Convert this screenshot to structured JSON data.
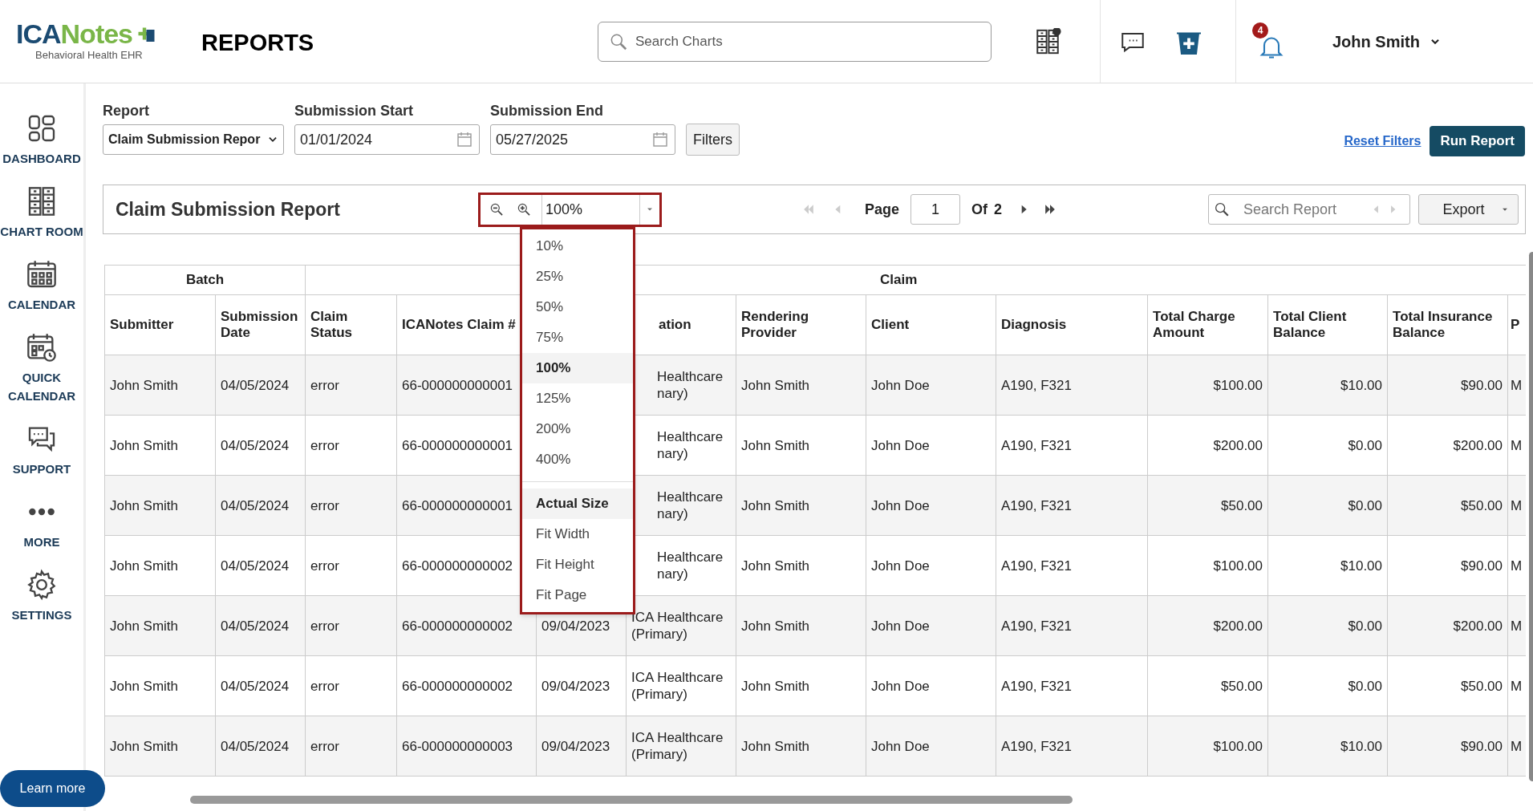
{
  "header": {
    "logo": {
      "brand_prefix": "ICA",
      "brand_suffix": "Notes",
      "tagline": "Behavioral Health EHR"
    },
    "page_title": "REPORTS",
    "search": {
      "placeholder": "Search Charts"
    },
    "notification_count": "4",
    "user": "John Smith"
  },
  "sidebar": {
    "items": [
      {
        "label": "DASHBOARD"
      },
      {
        "label": "CHART ROOM"
      },
      {
        "label": "CALENDAR"
      },
      {
        "label": "QUICK CALENDAR"
      },
      {
        "label": "SUPPORT"
      },
      {
        "label": "MORE"
      },
      {
        "label": "SETTINGS"
      }
    ],
    "learn_more": "Learn more"
  },
  "filters": {
    "report": {
      "label": "Report",
      "value": "Claim Submission Repor"
    },
    "start": {
      "label": "Submission Start",
      "value": "01/01/2024"
    },
    "end": {
      "label": "Submission End",
      "value": "05/27/2025"
    },
    "filters_button": "Filters",
    "reset": "Reset Filters",
    "run": "Run Report"
  },
  "viewer": {
    "title": "Claim Submission Report",
    "zoom": "100%",
    "page_label": "Page",
    "page": "1",
    "of_label": "Of",
    "page_count": "2",
    "search": {
      "placeholder": "Search Report"
    },
    "export": "Export"
  },
  "zoom_menu": [
    {
      "label": "10%",
      "kind": "zoom",
      "selected": false
    },
    {
      "label": "25%",
      "kind": "zoom",
      "selected": false
    },
    {
      "label": "50%",
      "kind": "zoom",
      "selected": false
    },
    {
      "label": "75%",
      "kind": "zoom",
      "selected": false
    },
    {
      "label": "100%",
      "kind": "zoom",
      "selected": true
    },
    {
      "label": "125%",
      "kind": "zoom",
      "selected": false
    },
    {
      "label": "200%",
      "kind": "zoom",
      "selected": false
    },
    {
      "label": "400%",
      "kind": "zoom",
      "selected": false
    },
    {
      "label": "Actual Size",
      "kind": "fit",
      "selected": true
    },
    {
      "label": "Fit Width",
      "kind": "fit",
      "selected": false
    },
    {
      "label": "Fit Height",
      "kind": "fit",
      "selected": false
    },
    {
      "label": "Fit Page",
      "kind": "fit",
      "selected": false
    }
  ],
  "table": {
    "groups": [
      {
        "label": "Batch"
      },
      {
        "label": "Claim"
      }
    ],
    "columns": [
      {
        "label": "Submitter"
      },
      {
        "label": "Submission Date"
      },
      {
        "label": "Claim Status"
      },
      {
        "label": "ICANotes Claim #"
      },
      {},
      {
        "label": "ation"
      },
      {
        "label": "Rendering Provider"
      },
      {
        "label": "Client"
      },
      {
        "label": "Diagnosis"
      },
      {
        "label": "Total Charge Amount"
      },
      {
        "label": "Total Client Balance"
      },
      {
        "label": "Total Insurance Balance"
      },
      {
        "label": "P"
      }
    ],
    "rows": [
      {
        "under_menu": true,
        "cells": [
          "John Smith",
          "04/05/2024",
          "error",
          "66-000000000001",
          null,
          "Healthcare nary)",
          "John Smith",
          "John Doe",
          "A190, F321",
          "$100.00",
          "$10.00",
          "$90.00",
          "M"
        ]
      },
      {
        "under_menu": true,
        "cells": [
          "John Smith",
          "04/05/2024",
          "error",
          "66-000000000001",
          null,
          "Healthcare nary)",
          "John Smith",
          "John Doe",
          "A190, F321",
          "$200.00",
          "$0.00",
          "$200.00",
          "M"
        ]
      },
      {
        "under_menu": true,
        "cells": [
          "John Smith",
          "04/05/2024",
          "error",
          "66-000000000001",
          null,
          "Healthcare nary)",
          "John Smith",
          "John Doe",
          "A190, F321",
          "$50.00",
          "$0.00",
          "$50.00",
          "M"
        ]
      },
      {
        "under_menu": true,
        "cells": [
          "John Smith",
          "04/05/2024",
          "error",
          "66-000000000002",
          null,
          "Healthcare nary)",
          "John Smith",
          "John Doe",
          "A190, F321",
          "$100.00",
          "$10.00",
          "$90.00",
          "M"
        ]
      },
      {
        "under_menu": false,
        "cells": [
          "John Smith",
          "04/05/2024",
          "error",
          "66-000000000002",
          "09/04/2023",
          "ICA Healthcare (Primary)",
          "John Smith",
          "John Doe",
          "A190, F321",
          "$200.00",
          "$0.00",
          "$200.00",
          "M"
        ]
      },
      {
        "under_menu": false,
        "cells": [
          "John Smith",
          "04/05/2024",
          "error",
          "66-000000000002",
          "09/04/2023",
          "ICA Healthcare (Primary)",
          "John Smith",
          "John Doe",
          "A190, F321",
          "$50.00",
          "$0.00",
          "$50.00",
          "M"
        ]
      },
      {
        "under_menu": false,
        "cells": [
          "John Smith",
          "04/05/2024",
          "error",
          "66-000000000003",
          "09/04/2023",
          "ICA Healthcare (Primary)",
          "John Smith",
          "John Doe",
          "A190, F321",
          "$100.00",
          "$10.00",
          "$90.00",
          "M"
        ]
      }
    ]
  }
}
